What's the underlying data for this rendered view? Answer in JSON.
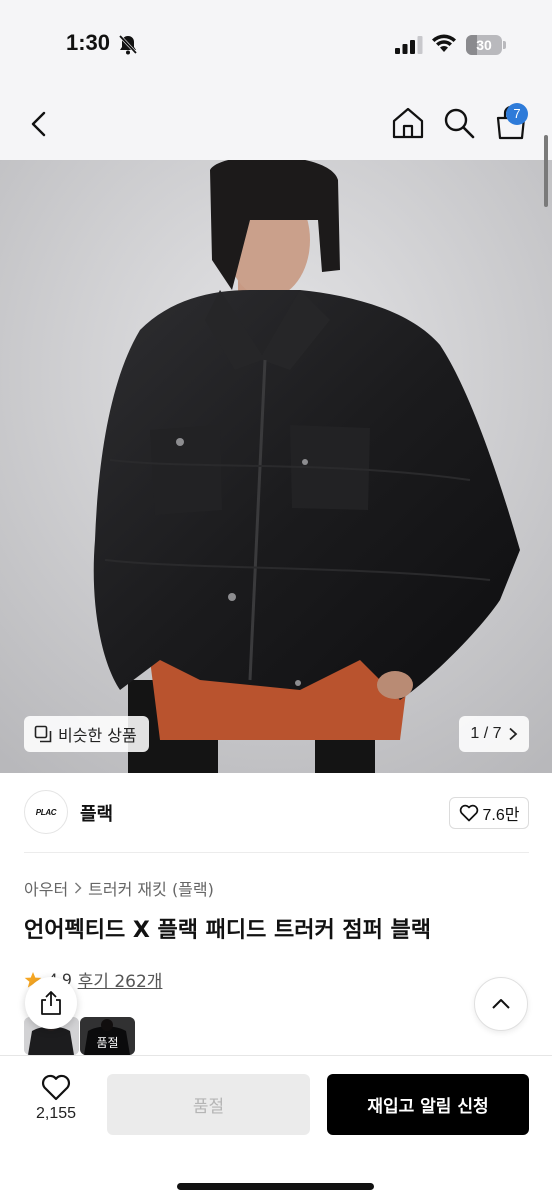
{
  "status_bar": {
    "time": "1:30",
    "battery_level": "30",
    "battery_fraction": 0.3
  },
  "nav": {
    "cart_count": "7"
  },
  "gallery": {
    "similar_label": "비슷한 상품",
    "page_indicator": "1 / 7"
  },
  "brand": {
    "logo_text": "PLAC",
    "name": "플랙",
    "likes": "7.6만"
  },
  "breadcrumb": {
    "category": "아우터",
    "subcategory": "트러커 재킷 (플랙)"
  },
  "product": {
    "title": "언어펙티드 X 플랙 패디드 트러커 점퍼 블랙",
    "rating": "4.9",
    "reviews": "후기 262개"
  },
  "thumbnails": {
    "soldout_label": "품절"
  },
  "bottom_bar": {
    "wish_count": "2,155",
    "soldout_label": "품절",
    "restock_label": "재입고 알림 신청"
  },
  "colors": {
    "accent_badge": "#2e7bd9",
    "primary_button": "#000000",
    "disabled_button": "#ebebeb",
    "star": "#f5a623"
  },
  "icons": [
    "bell-slash-icon",
    "signal-icon",
    "wifi-icon",
    "back-icon",
    "home-icon",
    "search-icon",
    "cart-icon",
    "similar-icon",
    "chevron-right-icon",
    "heart-icon",
    "star-icon",
    "share-icon",
    "chevron-up-icon"
  ]
}
